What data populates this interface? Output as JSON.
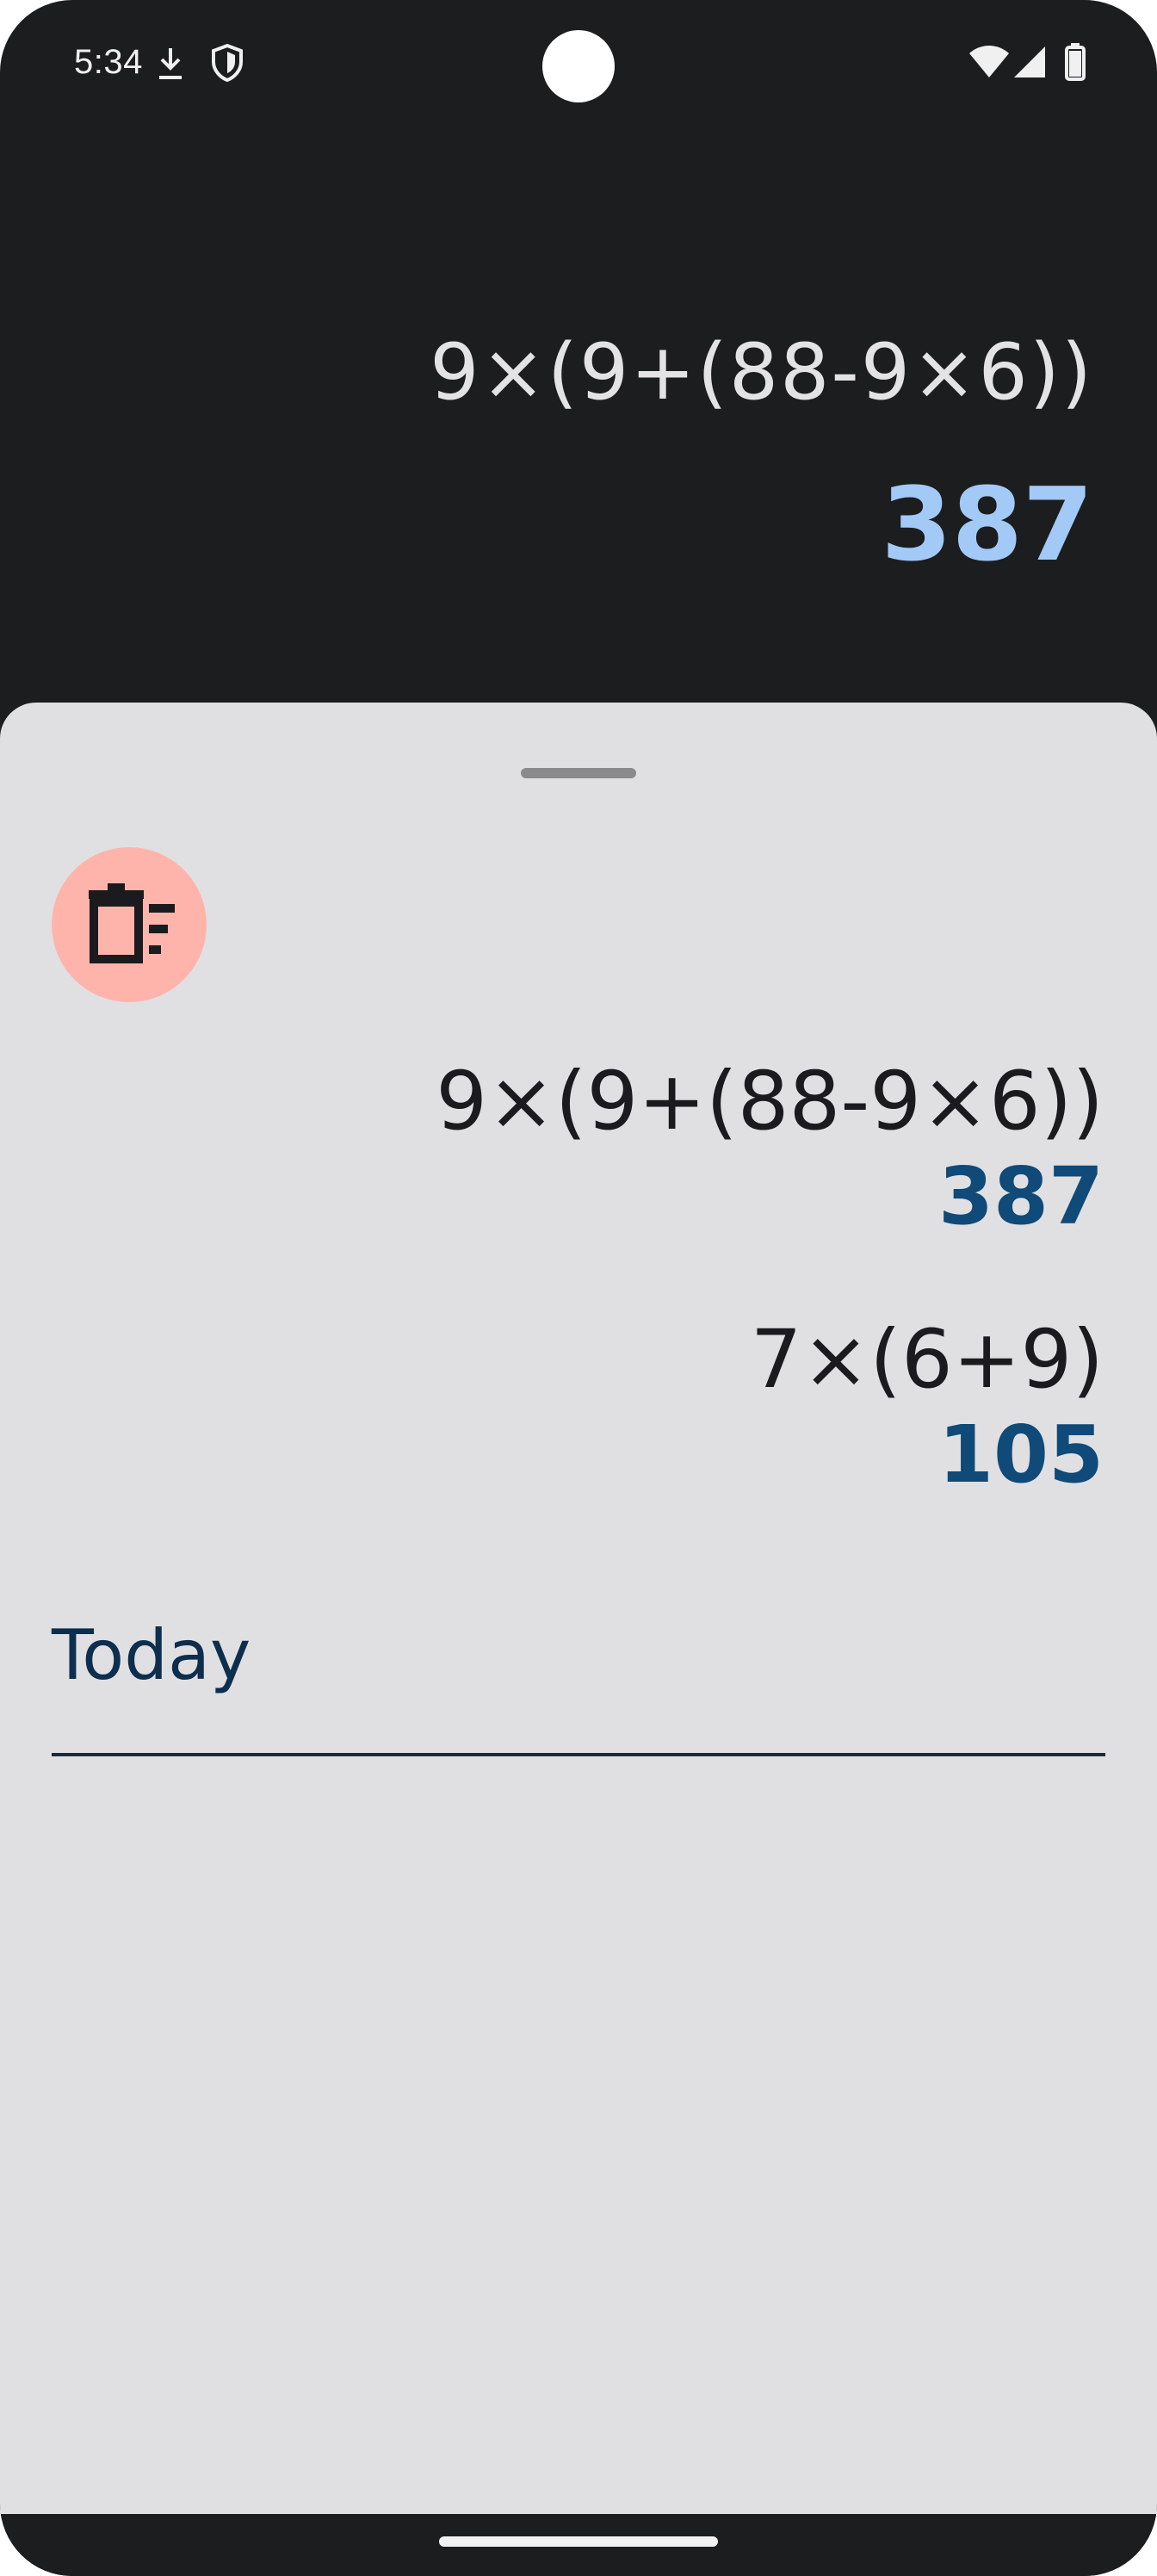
{
  "status_bar": {
    "time": "5:34",
    "icons_left": [
      "download-icon",
      "shield-icon"
    ],
    "icons_right": [
      "wifi-icon",
      "signal-icon",
      "battery-icon"
    ]
  },
  "display": {
    "expression": "9×(9+(88-9×6))",
    "result": "387"
  },
  "history": {
    "clear_button_icon": "delete-sweep-icon",
    "items": [
      {
        "expression": "9×(9+(88-9×6))",
        "result": "387"
      },
      {
        "expression": "7×(6+9)",
        "result": "105"
      }
    ],
    "section_label": "Today"
  },
  "colors": {
    "background_dark": "#1c1d1f",
    "sheet_background": "#e0e0e3",
    "result_accent": "#a3c9f7",
    "history_result": "#0f4a78",
    "clear_button": "#ffb4ab"
  }
}
